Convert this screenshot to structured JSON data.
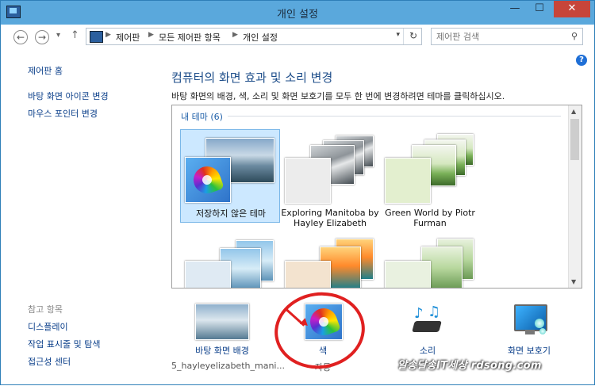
{
  "window": {
    "title": "개인 설정",
    "minimize_glyph": "—",
    "maximize_glyph": "☐",
    "close_glyph": "✕"
  },
  "address": {
    "crumbs": [
      "제어판",
      "모든 제어판 항목",
      "개인 설정"
    ],
    "refresh_glyph": "↻",
    "dropdown_glyph": "▾"
  },
  "search": {
    "placeholder": "제어판 검색",
    "icon": "search-icon"
  },
  "nav": {
    "back": "←",
    "forward": "→",
    "recent": "▾",
    "up": "↑"
  },
  "sidebar": {
    "home": "제어판 홈",
    "links": [
      "바탕 화면 아이콘 변경",
      "마우스 포인터 변경"
    ],
    "see_also_title": "참고 항목",
    "see_also": [
      "디스플레이",
      "작업 표시줄 및 탐색",
      "접근성 센터"
    ]
  },
  "main": {
    "title": "컴퓨터의 화면 효과 및 소리 변경",
    "description": "바탕 화면의 배경, 색, 소리 및 화면 보호기를 모두 한 번에 변경하려면 테마를 클릭하십시오.",
    "help_glyph": "?"
  },
  "themes": {
    "group_label": "내 테마 (6)",
    "items": [
      {
        "name": "저장하지 않은 테마",
        "selected": true
      },
      {
        "name": "Exploring Manitoba by Hayley Elizabeth",
        "line1": "Exploring Manitoba by",
        "line2": "Hayley Elizabeth",
        "selected": false
      },
      {
        "name": "Green World by Piotr Furman",
        "line1": "Green World by Piotr",
        "line2": "Furman",
        "selected": false
      }
    ]
  },
  "bottom": {
    "background": {
      "label": "바탕 화면 배경",
      "sub": "5_hayleyelizabeth_mani..."
    },
    "color": {
      "label": "색",
      "sub": "자동"
    },
    "sound": {
      "label": "소리"
    },
    "screensaver": {
      "label": "화면 보호기"
    }
  },
  "watermark": "알송달송IT세상 rdsong.com",
  "colors": {
    "title_bar": "#5aa8dc",
    "close": "#c7453a",
    "link": "#0b3f8a",
    "heading": "#1e4e8a",
    "annotation": "#e02020",
    "selected_tile": "#cce8ff"
  }
}
